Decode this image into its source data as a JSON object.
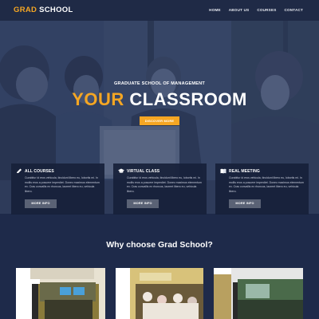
{
  "header": {
    "logo_part1": "GRAD",
    "logo_part2": " SCHOOL",
    "nav": [
      "HOME",
      "ABOUT US",
      "COURSES",
      "CONTACT"
    ]
  },
  "hero": {
    "subtitle": "GRADUATE SCHOOL OF MANAGEMENT",
    "title_part1": "YOUR",
    "title_part2": " CLASSROOM",
    "button": "DISCOVER MORE"
  },
  "features": [
    {
      "icon": "pencil-icon",
      "title": "ALL COURSES",
      "text": "Curabitur id eros vehicula, tincidunt libero eu, lobortis mi. In mollis eros a posuere imperdiet. Donec maximus elementum ex. Cras convallis ex rhoncus, laoreet libero eu, vehicula libero.",
      "button": "MORE INFO"
    },
    {
      "icon": "graduation-cap-icon",
      "title": "VIRTUAL CLASS",
      "text": "Curabitur id eros vehicula, tincidunt libero eu, lobortis mi. In mollis eros a posuere imperdiet. Donec maximus elementum ex. Cras convallis ex rhoncus, laoreet libero eu, vehicula libero.",
      "button": "MORE INFO"
    },
    {
      "icon": "book-icon",
      "title": "REAL MEETING",
      "text": "Curabitur id eros vehicula, tincidunt libero eu, lobortis mi. In mollis eros a posuere imperdiet. Donec maximus elementum ex. Cras convallis ex rhoncus, laoreet libero eu, vehicula libero.",
      "button": "MORE INFO"
    }
  ],
  "why": {
    "title": "Why choose Grad School?"
  },
  "colors": {
    "accent": "#f5a623",
    "header_bg": "#1f2a46",
    "section_bg": "#1e2a4a",
    "card_bg": "#17213a",
    "card_button": "#5a6275"
  }
}
